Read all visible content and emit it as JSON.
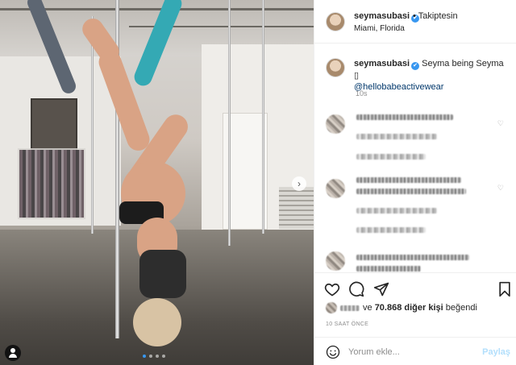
{
  "post": {
    "username": "seymasubasi",
    "follow_label": "• Takiptesin",
    "location": "Miami, Florida",
    "verified_mark": "✔",
    "carousel_next": "›",
    "caption": {
      "username": "seymasubasi",
      "text": "Seyma being Seyma ▯",
      "mention": "@hellobabeactivewear",
      "time": "10s"
    },
    "likes": {
      "connector": "ve",
      "count": "70.868 diğer kişi",
      "suffix": "beğendi"
    },
    "posted_ago": "10 SAAT ÖNCE",
    "composer": {
      "placeholder": "Yorum ekle...",
      "share_label": "Paylaş"
    }
  },
  "colors": {
    "accent": "#3897f0",
    "share_disabled": "#b2dffc",
    "text": "#262626",
    "muted": "#8e8e8e",
    "mention": "#00376b"
  },
  "icons": [
    "like-heart-icon",
    "comment-bubble-icon",
    "share-send-icon",
    "bookmark-icon",
    "emoji-smile-icon",
    "tag-user-icon",
    "verified-badge-icon",
    "chevron-right-icon"
  ]
}
